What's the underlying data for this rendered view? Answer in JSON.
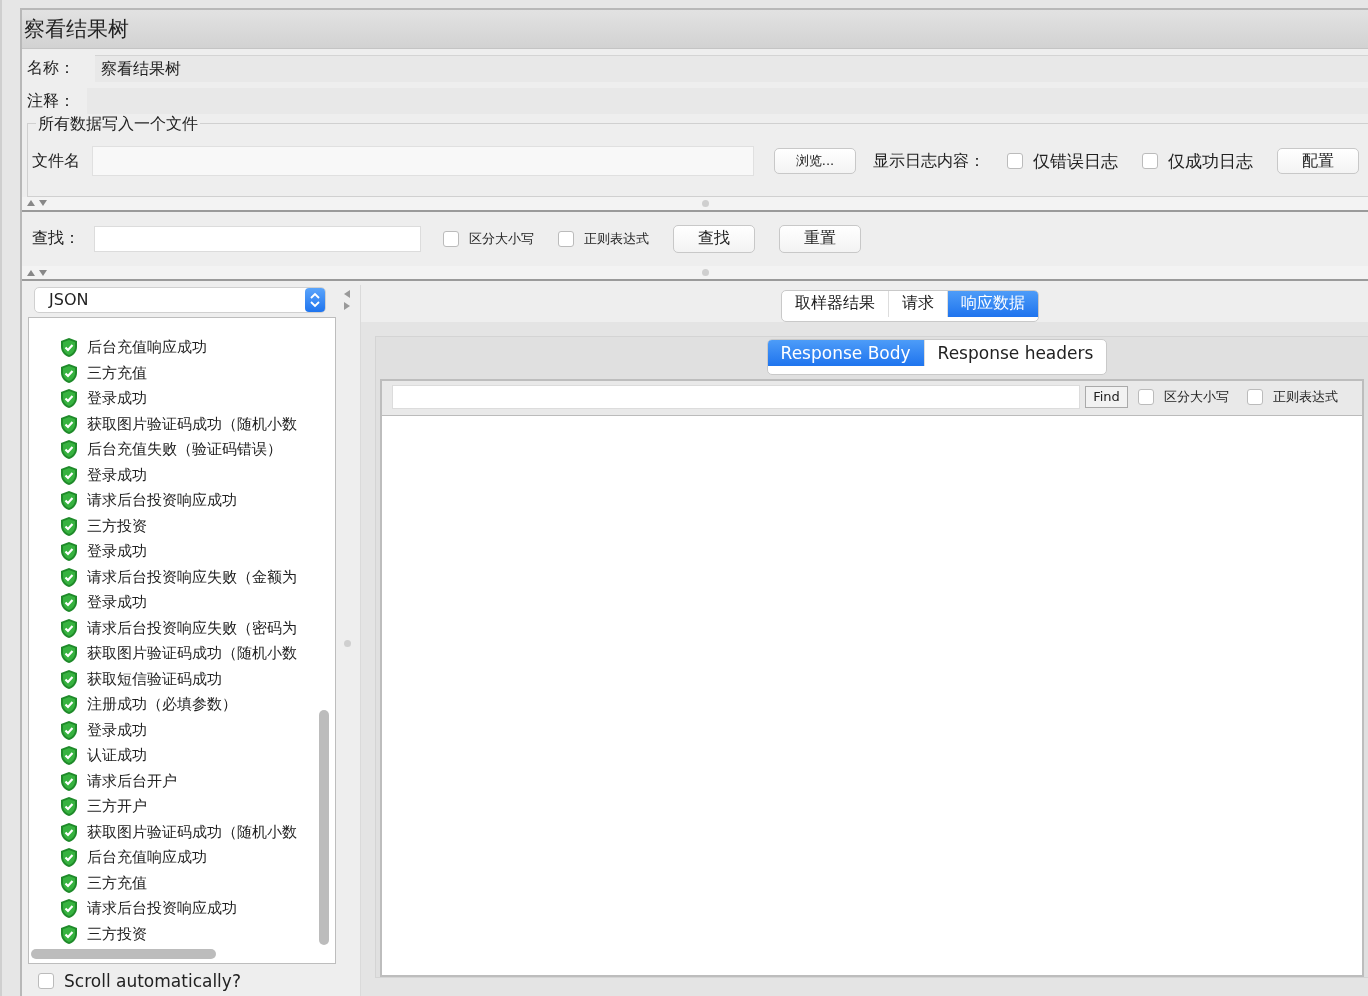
{
  "window": {
    "title": "察看结果树"
  },
  "name_field": {
    "label": "名称：",
    "value": "察看结果树"
  },
  "comment_field": {
    "label": "注释："
  },
  "file_section": {
    "title": "所有数据写入一个文件",
    "filename_label": "文件名",
    "browse_button": "浏览...",
    "log_label": "显示日志内容：",
    "options": [
      {
        "label": "仅错误日志",
        "checked": false
      },
      {
        "label": "仅成功日志",
        "checked": false
      }
    ],
    "config_button": "配置"
  },
  "search": {
    "label": "查找：",
    "options": [
      {
        "label": "区分大小写",
        "checked": false
      },
      {
        "label": "正则表达式",
        "checked": false
      }
    ],
    "buttons": [
      "查找",
      "重置"
    ]
  },
  "renderer": {
    "value": "JSON"
  },
  "results_tree": {
    "items": [
      {
        "label": "后台充值响应成功"
      },
      {
        "label": "三方充值"
      },
      {
        "label": "登录成功"
      },
      {
        "label": "获取图片验证码成功（随机小数"
      },
      {
        "label": "后台充值失败（验证码错误）"
      },
      {
        "label": "登录成功"
      },
      {
        "label": "请求后台投资响应成功"
      },
      {
        "label": "三方投资"
      },
      {
        "label": "登录成功"
      },
      {
        "label": "请求后台投资响应失败（金额为"
      },
      {
        "label": "登录成功"
      },
      {
        "label": "请求后台投资响应失败（密码为"
      },
      {
        "label": "获取图片验证码成功（随机小数"
      },
      {
        "label": "获取短信验证码成功"
      },
      {
        "label": "注册成功（必填参数）"
      },
      {
        "label": "登录成功"
      },
      {
        "label": "认证成功"
      },
      {
        "label": "请求后台开户"
      },
      {
        "label": "三方开户"
      },
      {
        "label": "获取图片验证码成功（随机小数"
      },
      {
        "label": "后台充值响应成功"
      },
      {
        "label": "三方充值"
      },
      {
        "label": "请求后台投资响应成功"
      },
      {
        "label": "三方投资"
      }
    ]
  },
  "tabs": [
    {
      "label": "取样器结果",
      "selected": false
    },
    {
      "label": "请求",
      "selected": false
    },
    {
      "label": "响应数据",
      "selected": true
    }
  ],
  "sub_tabs": [
    {
      "label": "Response Body",
      "selected": true
    },
    {
      "label": "Response headers",
      "selected": false
    }
  ],
  "response_search": {
    "button": "Find",
    "options": [
      {
        "label": "区分大小写",
        "checked": false
      },
      {
        "label": "正则表达式",
        "checked": false
      }
    ]
  },
  "scroll_automatically": {
    "label": "Scroll automatically?",
    "checked": false
  }
}
